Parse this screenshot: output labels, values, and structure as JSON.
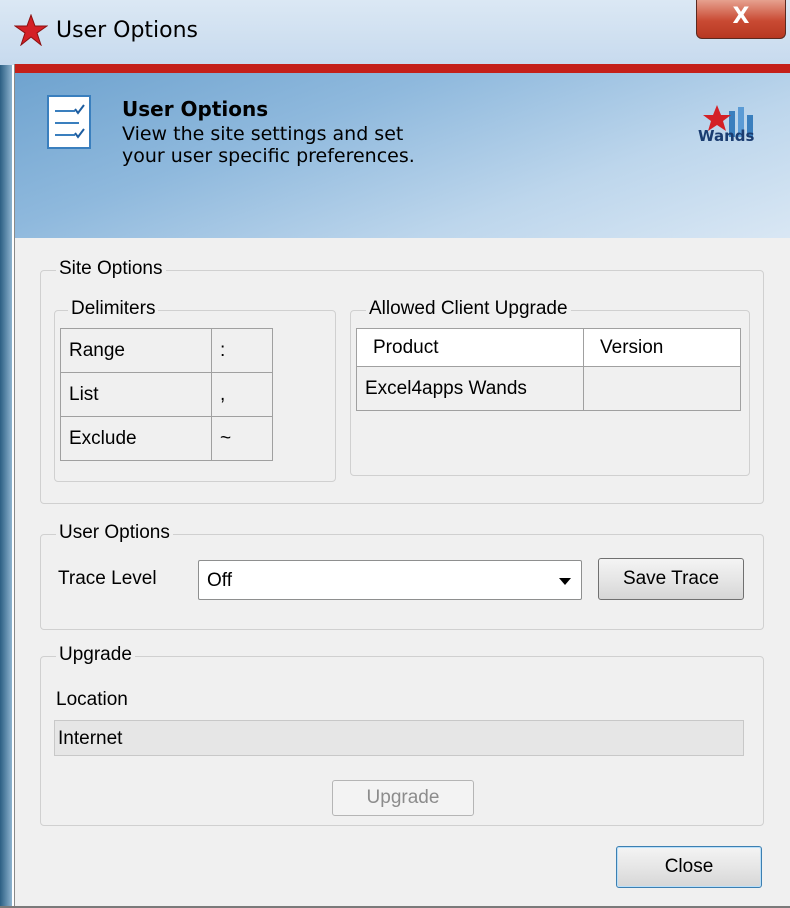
{
  "window": {
    "title": "User Options",
    "close_label": "X"
  },
  "banner": {
    "title": "User Options",
    "description": "View the site settings and set your user specific preferences.",
    "logo_text": "Wands"
  },
  "site_options": {
    "label": "Site Options",
    "delimiters": {
      "label": "Delimiters",
      "rows": [
        {
          "name": "Range",
          "value": ":"
        },
        {
          "name": "List",
          "value": ","
        },
        {
          "name": "Exclude",
          "value": "~"
        }
      ]
    },
    "allowed_upgrade": {
      "label": "Allowed Client Upgrade",
      "columns": [
        "Product",
        "Version"
      ],
      "rows": [
        {
          "product": "Excel4apps Wands",
          "version": ""
        }
      ]
    }
  },
  "user_options": {
    "label": "User Options",
    "trace_level_label": "Trace Level",
    "trace_level_value": "Off",
    "save_trace_label": "Save Trace"
  },
  "upgrade": {
    "label": "Upgrade",
    "location_label": "Location",
    "location_value": "Internet",
    "upgrade_button_label": "Upgrade"
  },
  "footer": {
    "close_label": "Close"
  },
  "colors": {
    "accent_red": "#c4201a",
    "banner_blue": "#6fa3cf"
  }
}
